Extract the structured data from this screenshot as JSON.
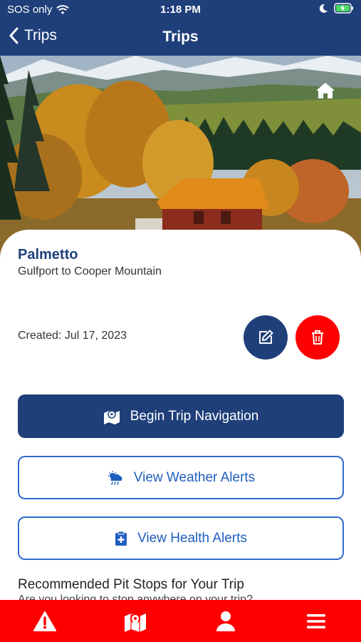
{
  "status_bar": {
    "carrier": "SOS only",
    "time": "1:18 PM"
  },
  "nav": {
    "back_label": "Trips",
    "title": "Trips"
  },
  "trip": {
    "name": "Palmetto",
    "route": "Gulfport to Cooper Mountain",
    "created": "Created: Jul 17, 2023"
  },
  "actions": {
    "begin_navigation": "Begin Trip Navigation",
    "weather_alerts": "View Weather Alerts",
    "health_alerts": "View Health Alerts"
  },
  "pit_stops": {
    "title": "Recommended Pit Stops for Your Trip",
    "subtitle": "Are you looking to stop anywhere on your trip?"
  },
  "colors": {
    "primary": "#1f3f7a",
    "danger": "#ff0000",
    "link_blue": "#1f5fbf"
  },
  "tab_bar": {
    "icons": [
      "warning-icon",
      "map-icon",
      "profile-icon",
      "menu-icon"
    ]
  }
}
